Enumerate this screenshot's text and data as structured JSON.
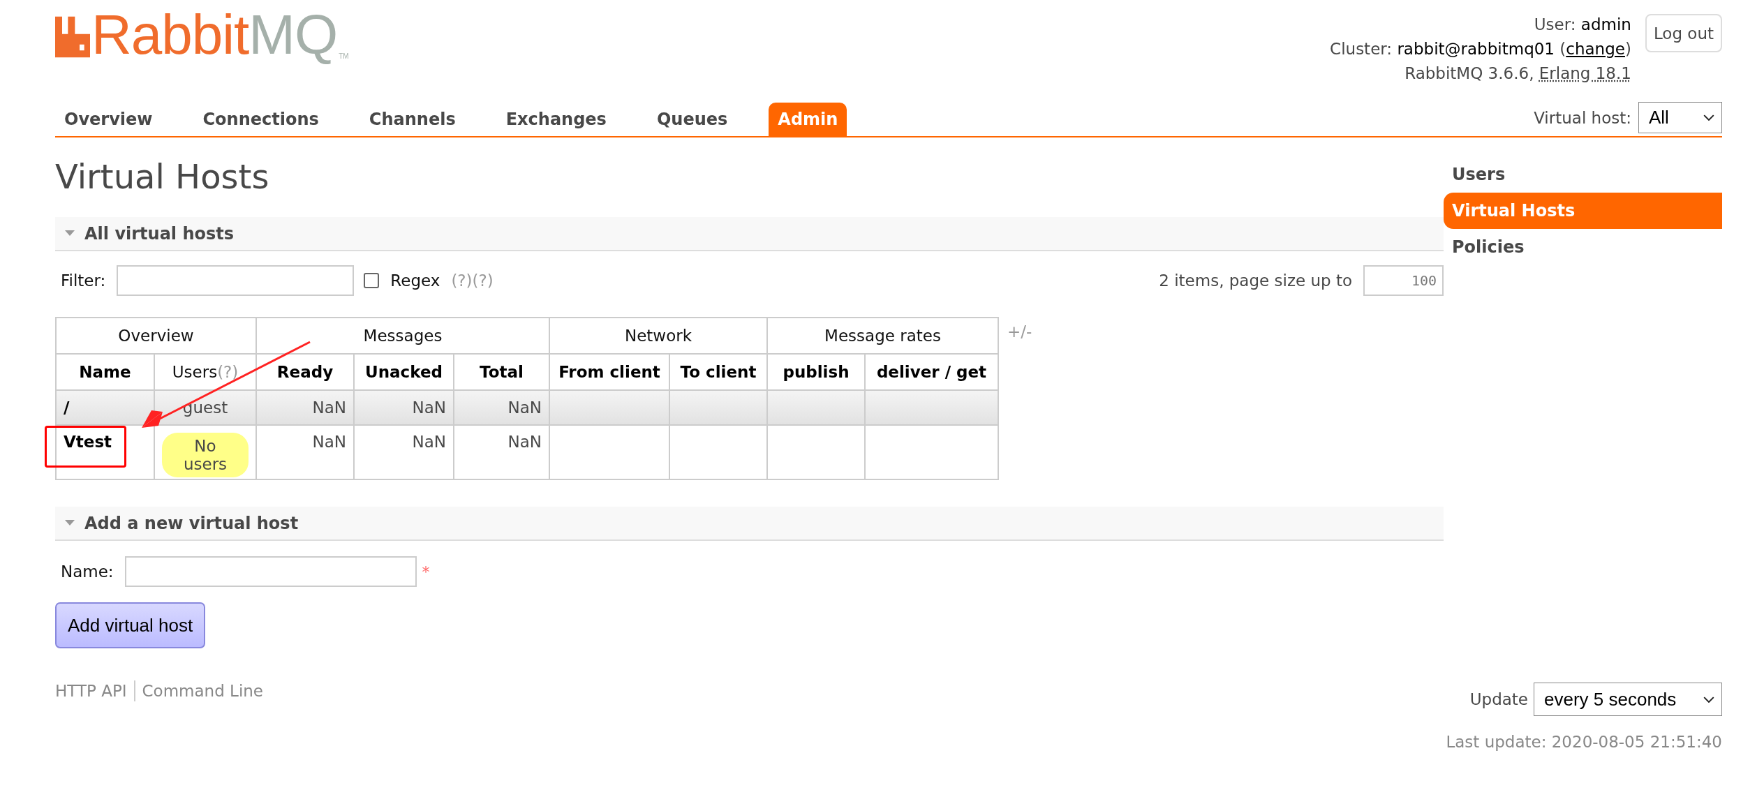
{
  "logo": {
    "name": "Rabbit",
    "suffix": "MQ",
    "tm": "TM"
  },
  "user": {
    "label": "User:",
    "value": "admin"
  },
  "cluster": {
    "label": "Cluster:",
    "value": "rabbit@rabbitmq01",
    "open": "(",
    "link": "change",
    "close": ")"
  },
  "version": {
    "text": "RabbitMQ 3.6.6,",
    "erlang": "Erlang 18.1"
  },
  "logout": "Log out",
  "tabs": [
    {
      "label": "Overview",
      "selected": false
    },
    {
      "label": "Connections",
      "selected": false
    },
    {
      "label": "Channels",
      "selected": false
    },
    {
      "label": "Exchanges",
      "selected": false
    },
    {
      "label": "Queues",
      "selected": false
    },
    {
      "label": "Admin",
      "selected": true
    }
  ],
  "vhost_select": {
    "label": "Virtual host:",
    "value": "All"
  },
  "title": "Virtual Hosts",
  "sidebar": [
    {
      "label": "Users",
      "selected": false
    },
    {
      "label": "Virtual Hosts",
      "selected": true
    },
    {
      "label": "Policies",
      "selected": false
    }
  ],
  "all_section": {
    "title": "All virtual hosts",
    "expanded": true
  },
  "filter": {
    "label": "Filter:",
    "regex_label": "Regex",
    "regex_checked": false,
    "help": [
      "(?)",
      "(?)"
    ]
  },
  "paging": {
    "text": "2 items, page size up to",
    "page_size": "100"
  },
  "table": {
    "groups": [
      {
        "label": "Overview",
        "columns": [
          {
            "label": "Name",
            "bold": true
          },
          {
            "label": "Users",
            "bold": false,
            "help": "(?)"
          }
        ]
      },
      {
        "label": "Messages",
        "columns": [
          {
            "label": "Ready",
            "bold": true
          },
          {
            "label": "Unacked",
            "bold": true
          },
          {
            "label": "Total",
            "bold": true
          }
        ]
      },
      {
        "label": "Network",
        "columns": [
          {
            "label": "From client",
            "bold": true
          },
          {
            "label": "To client",
            "bold": true
          }
        ]
      },
      {
        "label": "Message rates",
        "columns": [
          {
            "label": "publish",
            "bold": true
          },
          {
            "label": "deliver / get",
            "bold": true
          }
        ]
      }
    ],
    "toggle": "+/-",
    "rows": [
      {
        "name": "/",
        "users": {
          "text": "guest",
          "kind": "plain"
        },
        "messages": [
          "NaN",
          "NaN",
          "NaN"
        ],
        "highlighted": false
      },
      {
        "name": "Vtest",
        "users": {
          "text": "No users",
          "kind": "warning"
        },
        "messages": [
          "NaN",
          "NaN",
          "NaN"
        ],
        "highlighted": true
      }
    ]
  },
  "add_section": {
    "title": "Add a new virtual host",
    "expanded": true
  },
  "name_field": {
    "label": "Name:",
    "required_mark": "*"
  },
  "add_button": "Add virtual host",
  "footer_links": [
    "HTTP API",
    "Command Line"
  ],
  "update": {
    "label": "Update",
    "value": "every 5 seconds"
  },
  "last_update": "Last update: 2020-08-05 21:51:40"
}
